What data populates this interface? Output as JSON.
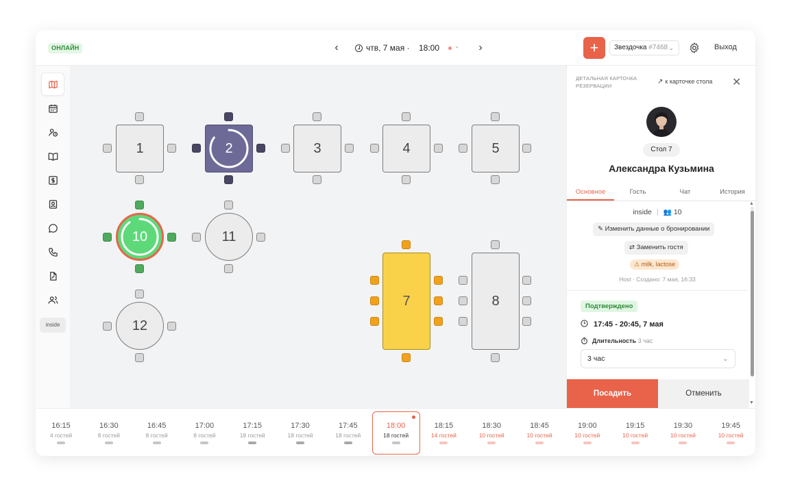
{
  "header": {
    "status_badge": "ОНЛАЙН",
    "date": "чтв, 7 мая ·",
    "time": "18:00",
    "restaurant_name": "Звездочка",
    "restaurant_id": "#7468",
    "logout_label": "Выход",
    "add_label": "+"
  },
  "sidebar": {
    "items": [
      "map-icon",
      "calendar-icon",
      "guests-clock-icon",
      "book-icon",
      "dollar-icon",
      "contact-card-icon",
      "chat-icon",
      "phone-icon",
      "document-icon",
      "people-icon"
    ],
    "active": "map-icon",
    "zone_tag": "inside"
  },
  "floor": {
    "tables": [
      {
        "label": "1",
        "shape": "square",
        "status": "free"
      },
      {
        "label": "2",
        "shape": "square",
        "status": "occupied",
        "progress": 0.85
      },
      {
        "label": "3",
        "shape": "square",
        "status": "free"
      },
      {
        "label": "4",
        "shape": "square",
        "status": "free"
      },
      {
        "label": "5",
        "shape": "square",
        "status": "free"
      },
      {
        "label": "10",
        "shape": "round",
        "status": "seated",
        "progress": 0.9
      },
      {
        "label": "11",
        "shape": "round",
        "status": "free"
      },
      {
        "label": "12",
        "shape": "round",
        "status": "free"
      },
      {
        "label": "7",
        "shape": "long",
        "status": "selected"
      },
      {
        "label": "8",
        "shape": "long",
        "status": "free"
      }
    ],
    "colors": {
      "free": "#ececec",
      "occupied": "#6e6a98",
      "seated": "#5ed97a",
      "selected": "#fad24a",
      "accent": "#e8634a"
    }
  },
  "panel": {
    "title": "ДЕТАЛЬНАЯ КАРТОЧКА РЕЗЕРВАЦИИ",
    "to_card": "к карточке стола",
    "table_chip": "Стол 7",
    "guest_name": "Александра Кузьмина",
    "tabs": [
      "Основное",
      "Гость",
      "Чат",
      "История"
    ],
    "active_tab": "Основное",
    "zone": "inside",
    "separator": "|",
    "guests": "10",
    "edit_booking": "Изменить данные о бронировании",
    "replace_guest": "Заменить гостя",
    "allergy": "milk, lactose",
    "created": "Host · Создано: 7 мая, 16:33",
    "status": "Подтверждено",
    "time_range": "17:45 - 20:45, 7 мая",
    "duration_label": "Длительность",
    "duration_hint": "3 час",
    "duration_value": "3 час",
    "seat_button": "Посадить",
    "cancel_button": "Отменить"
  },
  "timeline": {
    "slots": [
      {
        "time": "16:15",
        "guests": "4 гостей",
        "state": "past"
      },
      {
        "time": "16:30",
        "guests": "8 гостей",
        "state": "past"
      },
      {
        "time": "16:45",
        "guests": "8 гостей",
        "state": "past"
      },
      {
        "time": "17:00",
        "guests": "8 гостей",
        "state": "past"
      },
      {
        "time": "17:15",
        "guests": "18 гостей",
        "state": "heavy"
      },
      {
        "time": "17:30",
        "guests": "18 гостей",
        "state": "heavy"
      },
      {
        "time": "17:45",
        "guests": "18 гостей",
        "state": "heavy"
      },
      {
        "time": "18:00",
        "guests": "18 гостей",
        "state": "selected"
      },
      {
        "time": "18:15",
        "guests": "14 гостей",
        "state": "future"
      },
      {
        "time": "18:30",
        "guests": "10 гостей",
        "state": "future"
      },
      {
        "time": "18:45",
        "guests": "10 гостей",
        "state": "future"
      },
      {
        "time": "19:00",
        "guests": "10 гостей",
        "state": "future"
      },
      {
        "time": "19:15",
        "guests": "10 гостей",
        "state": "future"
      },
      {
        "time": "19:30",
        "guests": "10 гостей",
        "state": "future"
      },
      {
        "time": "19:45",
        "guests": "10 гостей",
        "state": "future"
      }
    ]
  }
}
